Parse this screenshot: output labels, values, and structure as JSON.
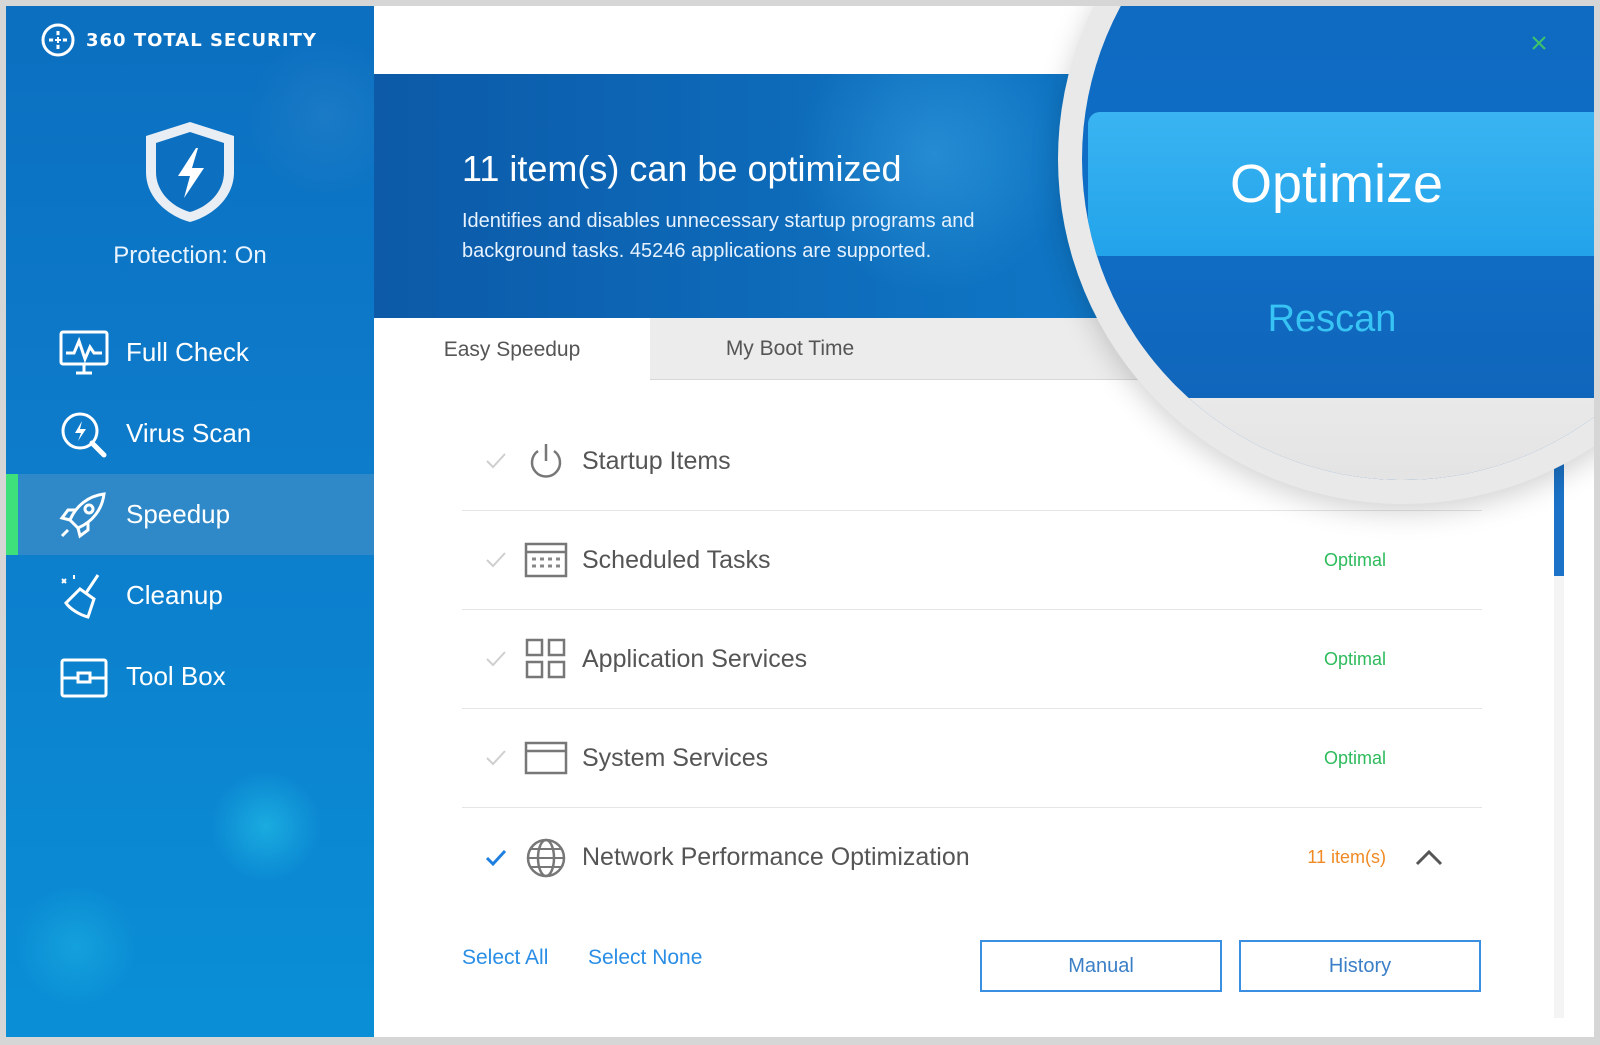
{
  "app": {
    "brand": "360 TOTAL SECURITY",
    "protection_status": "Protection: On"
  },
  "sidebar": {
    "items": [
      {
        "label": "Full Check",
        "icon": "monitor-pulse-icon",
        "active": false
      },
      {
        "label": "Virus Scan",
        "icon": "virus-scan-icon",
        "active": false
      },
      {
        "label": "Speedup",
        "icon": "rocket-icon",
        "active": true
      },
      {
        "label": "Cleanup",
        "icon": "broom-icon",
        "active": false
      },
      {
        "label": "Tool Box",
        "icon": "toolbox-icon",
        "active": false
      }
    ]
  },
  "header": {
    "title": "11 item(s) can be optimized",
    "description_line1": "Identifies and disables unnecessary startup programs and",
    "description_line2": "background tasks. 45246 applications are supported."
  },
  "magnifier": {
    "optimize_label": "Optimize",
    "rescan_label": "Rescan"
  },
  "tabs": [
    {
      "label": "Easy Speedup",
      "active": true
    },
    {
      "label": "My Boot Time",
      "active": false
    }
  ],
  "list": {
    "rows": [
      {
        "label": "Startup Items",
        "status": "",
        "icon": "power-icon",
        "checked": false
      },
      {
        "label": "Scheduled Tasks",
        "status": "Optimal",
        "icon": "calendar-icon",
        "checked": false
      },
      {
        "label": "Application Services",
        "status": "Optimal",
        "icon": "grid-icon",
        "checked": false
      },
      {
        "label": "System Services",
        "status": "Optimal",
        "icon": "window-icon",
        "checked": false
      },
      {
        "label": "Network Performance Optimization",
        "status": "11 item(s)",
        "icon": "globe-icon",
        "checked": true
      }
    ]
  },
  "footer": {
    "select_all": "Select All",
    "select_none": "Select None",
    "manual": "Manual",
    "history": "History"
  },
  "colors": {
    "sidebar_blue": "#0d7ccb",
    "header_blue": "#0e73c2",
    "active_indicator": "#3ee07b",
    "optimal_green": "#2dbb5b",
    "items_orange": "#f08a24",
    "link_blue": "#2a8ee6"
  }
}
